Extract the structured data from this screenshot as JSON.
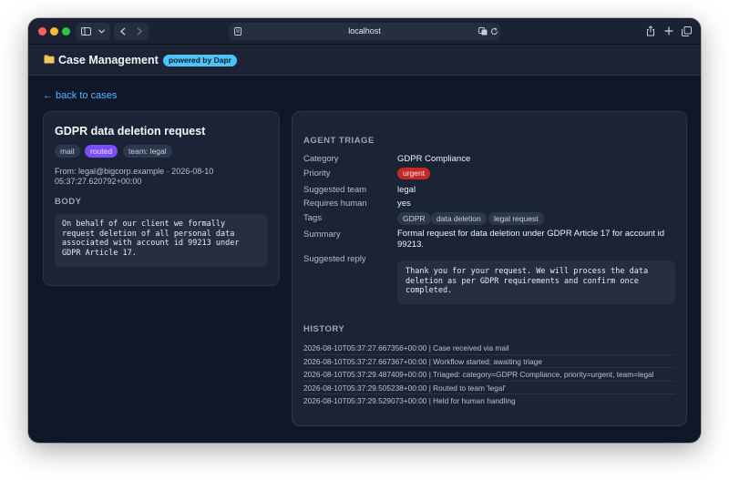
{
  "browser": {
    "url": "localhost"
  },
  "header": {
    "title": "Case Management",
    "badge": "powered by Dapr"
  },
  "back_link": "← back to cases",
  "case": {
    "title": "GDPR data deletion request",
    "chips": [
      "mail",
      "routed",
      "team: legal"
    ],
    "meta_line1": "From: legal@bigcorp.example · 2026-08-10",
    "meta_line2": "05:37:27.620792+00:00",
    "body_label": "BODY",
    "body": "On behalf of our client we formally\nrequest deletion of all personal data\nassociated with account id 99213 under\nGDPR Article 17."
  },
  "triage": {
    "heading": "AGENT TRIAGE",
    "category_label": "Category",
    "category": "GDPR Compliance",
    "priority_label": "Priority",
    "priority": "urgent",
    "team_label": "Suggested team",
    "team": "legal",
    "human_label": "Requires human",
    "human": "yes",
    "tags_label": "Tags",
    "tags": [
      "GDPR",
      "data deletion",
      "legal request"
    ],
    "summary_label": "Summary",
    "summary": "Formal request for data deletion under GDPR Article 17 for account id 99213.",
    "reply_label": "Suggested reply",
    "reply": "Thank you for your request. We will process the data deletion as per GDPR requirements and confirm once completed."
  },
  "history": {
    "heading": "HISTORY",
    "entries": [
      "2026-08-10T05:37:27.667356+00:00 | Case received via mail",
      "2026-08-10T05:37:27.667367+00:00 | Workflow started; awaiting triage",
      "2026-08-10T05:37:29.487409+00:00 | Triaged: category=GDPR Compliance, priority=urgent, team=legal",
      "2026-08-10T05:37:29.505238+00:00 | Routed to team 'legal'",
      "2026-08-10T05:37:29.529073+00:00 | Held for human handling"
    ]
  },
  "colors": {
    "accent": "#58b6ff",
    "dapr_badge": "#4fc3f7",
    "routed_chip": "#7c4dff",
    "urgent": "#c62828"
  },
  "icons": [
    "sidebar-toggle-icon",
    "chevron-down-icon",
    "back-arrow-icon",
    "forward-arrow-icon",
    "page-icon",
    "translate-icon",
    "reload-icon",
    "share-icon",
    "plus-icon",
    "tabs-icon",
    "folder-icon"
  ]
}
